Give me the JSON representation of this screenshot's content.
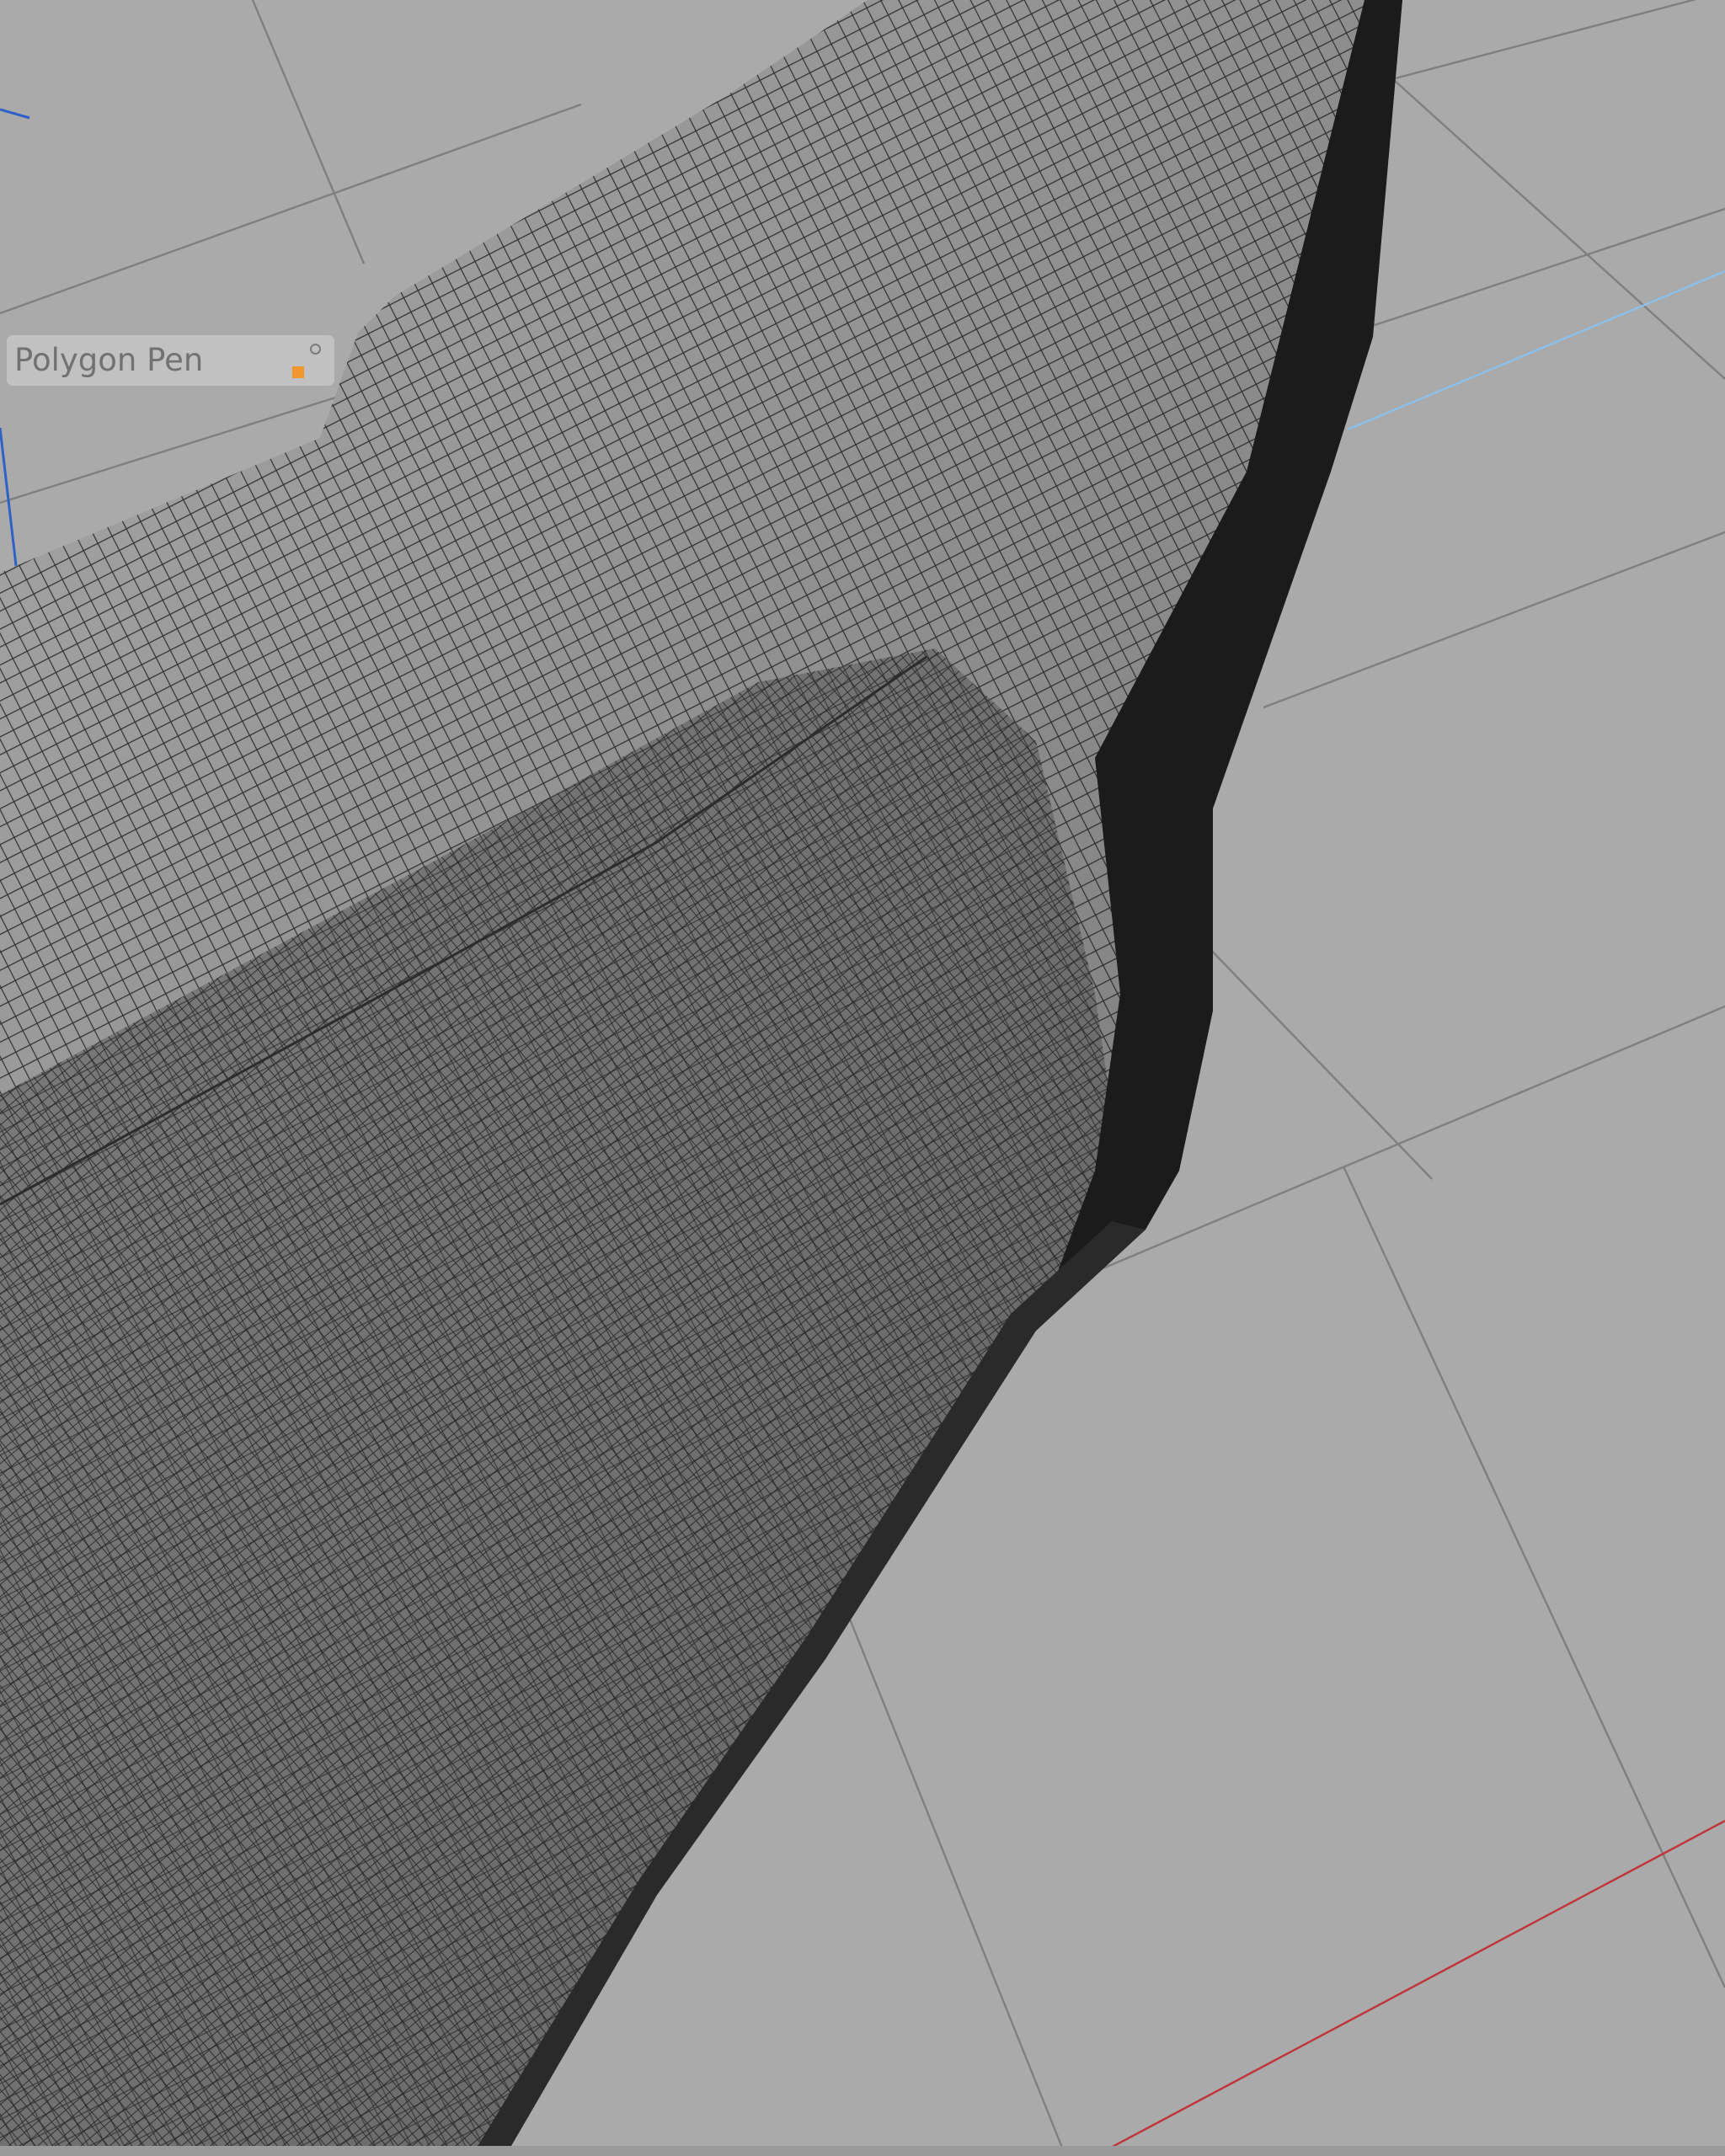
{
  "tool_hud": {
    "label": "Polygon Pen",
    "swatch_color": "#f0962d"
  },
  "viewport": {
    "background_color": "#aaaaaa",
    "grid_color": "#7f7f7f",
    "mesh_fill_color": "#8e8e8e",
    "wire_color": "#1e1e1e",
    "axis_x_color": "#c0333a",
    "axis_z_color": "#2e62c8"
  }
}
